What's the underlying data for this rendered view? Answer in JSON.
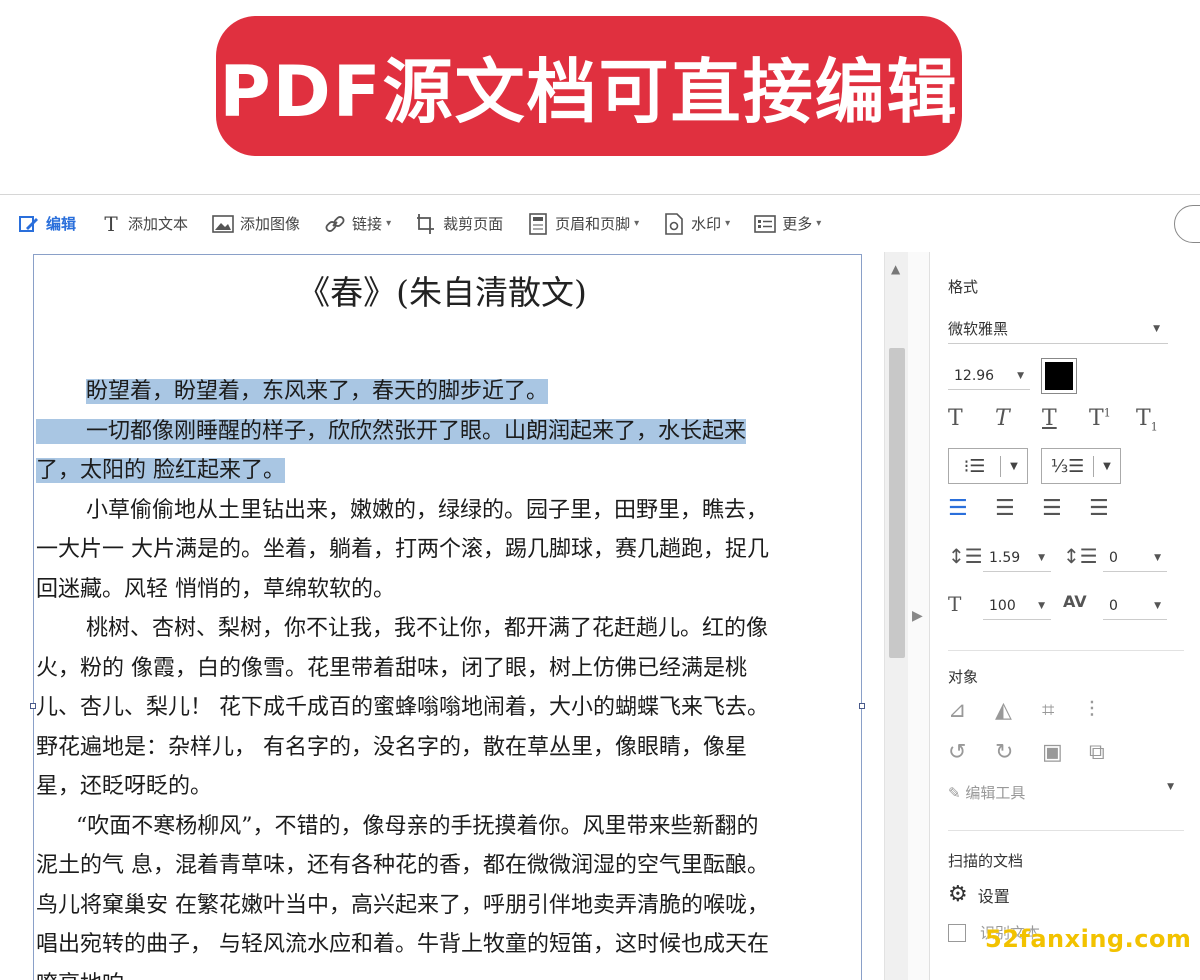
{
  "banner": {
    "text": "PDF源文档可直接编辑"
  },
  "toolbar": {
    "edit": "编辑",
    "add_text": "添加文本",
    "add_image": "添加图像",
    "link": "链接",
    "crop": "裁剪页面",
    "header_footer": "页眉和页脚",
    "watermark": "水印",
    "more": "更多"
  },
  "document": {
    "title": "《春》(朱自清散文)",
    "lines": [
      "盼望着，盼望着，东风来了，春天的脚步近了。",
      "一切都像刚睡醒的样子，欣欣然张开了眼。山朗润起来了，水长起来",
      "了，太阳的 脸红起来了。",
      "小草偷偷地从土里钻出来，嫩嫩的，绿绿的。园子里，田野里，瞧去，",
      "一大片一 大片满是的。坐着，躺着，打两个滚，踢几脚球，赛几趟跑，捉几",
      "回迷藏。风轻 悄悄的，草绵软软的。",
      "桃树、杏树、梨树，你不让我，我不让你，都开满了花赶趟儿。红的像",
      "火，粉的 像霞，白的像雪。花里带着甜味，闭了眼，树上仿佛已经满是桃",
      "儿、杏儿、梨儿！ 花下成千成百的蜜蜂嗡嗡地闹着，大小的蝴蝶飞来飞去。",
      "野花遍地是：杂样儿， 有名字的，没名字的，散在草丛里，像眼睛，像星",
      "星，还眨呀眨的。",
      "“吹面不寒杨柳风”，不错的，像母亲的手抚摸着你。风里带来些新翻的",
      "泥土的气 息，混着青草味，还有各种花的香，都在微微润湿的空气里酝酿。",
      "鸟儿将窠巢安 在繁花嫩叶当中，高兴起来了，呼朋引伴地卖弄清脆的喉咙，",
      "唱出宛转的曲子， 与轻风流水应和着。牛背上牧童的短笛，这时候也成天在",
      "嘹亮地响"
    ]
  },
  "panel": {
    "format_label": "格式",
    "font_name": "微软雅黑",
    "font_size": "12.96",
    "font_color": "#000000",
    "line_spacing": "1.59",
    "para_spacing": "0",
    "scale": "100",
    "char_spacing": "0",
    "object_label": "对象",
    "edit_tool": "编辑工具",
    "scanned_label": "扫描的文档",
    "settings": "设置",
    "ocr": "识别文本"
  },
  "watermark_text": "52fanxing.com",
  "colors": {
    "banner": "#e0303f",
    "highlight": "#a9c6e3",
    "accent": "#2a6fdb"
  }
}
